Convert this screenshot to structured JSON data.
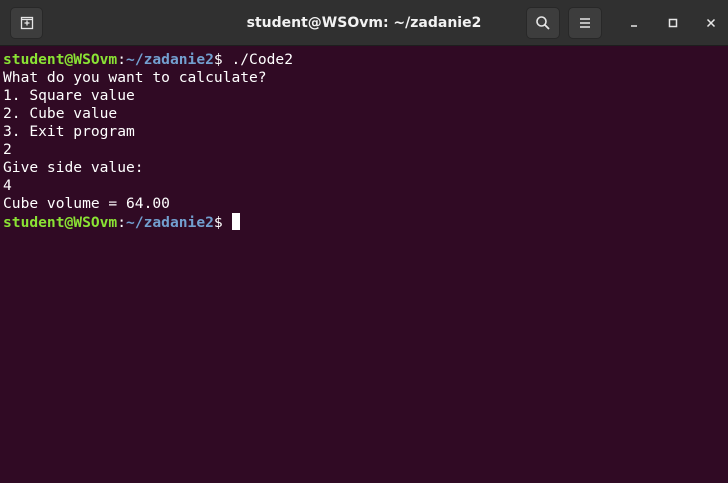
{
  "window": {
    "title": "student@WSOvm: ~/zadanie2"
  },
  "titlebar": {
    "buttons": {
      "new_tab_icon": "new-tab-icon",
      "search_icon": "search-icon",
      "menu_icon": "hamburger-menu-icon",
      "minimize_icon": "minimize-icon",
      "maximize_icon": "maximize-icon",
      "close_icon": "close-icon"
    }
  },
  "colors": {
    "terminal_background": "#300a24",
    "titlebar_background": "#303030",
    "prompt_user": "#8ae234",
    "prompt_path": "#729fcf",
    "text": "#ffffff"
  },
  "terminal": {
    "prompt1": {
      "user_host": "student@WSOvm",
      "separator": ":",
      "path": "~/zadanie2",
      "symbol": "$",
      "command": " ./Code2"
    },
    "output": [
      "What do you want to calculate?",
      "1. Square value",
      "2. Cube value",
      "3. Exit program",
      "2",
      "Give side value:",
      "4",
      "Cube volume = 64.00"
    ],
    "prompt2": {
      "user_host": "student@WSOvm",
      "separator": ":",
      "path": "~/zadanie2",
      "symbol": "$",
      "command": " "
    }
  }
}
